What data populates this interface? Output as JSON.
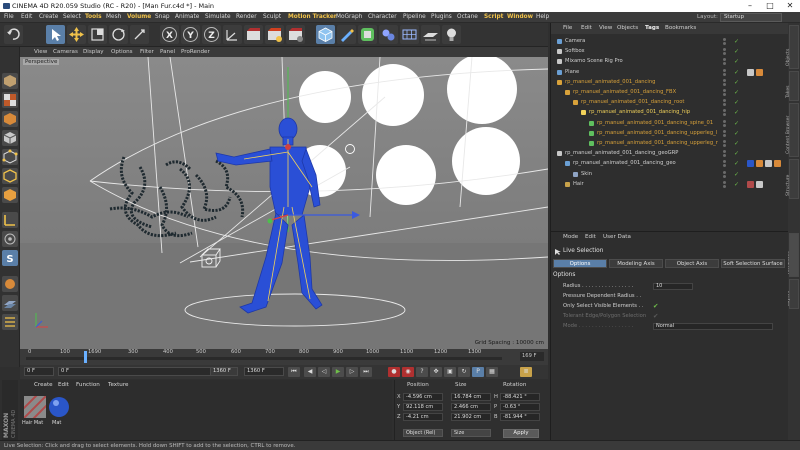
{
  "window": {
    "title": "CINEMA 4D R20.059 Studio (RC - R20) - [Man Fur.c4d *] - Main",
    "controls": [
      "–",
      "□",
      "✕"
    ]
  },
  "menubar": {
    "items": [
      "File",
      "Edit",
      "Create",
      "Select",
      "Tools",
      "Mesh",
      "Volume",
      "Snap",
      "Animate",
      "Simulate",
      "Render",
      "Sculpt",
      "Motion Tracker",
      "MoGraph",
      "Character",
      "Pipeline",
      "Plugins",
      "Octane",
      "Script",
      "Window",
      "Help"
    ],
    "highlighted": [
      "Tools",
      "Volume",
      "Motion Tracker",
      "Script",
      "Window"
    ],
    "layout_label": "Layout:",
    "layout_value": "Startup"
  },
  "toolbar": {
    "icons": [
      "undo-icon",
      "cursor-icon",
      "move-icon",
      "scale-icon",
      "rotate-icon",
      "recent-tools-icon",
      "x-axis-icon",
      "y-axis-icon",
      "z-axis-icon",
      "world-coords-icon",
      "render-view-icon",
      "render-picture-viewer-icon",
      "render-settings-icon",
      "cube-icon",
      "pen-icon",
      "subdivision-icon",
      "array-icon",
      "deformer-icon",
      "floor-icon",
      "camera-icon",
      "light-icon"
    ],
    "axis_labels": [
      "X",
      "Y",
      "Z"
    ]
  },
  "viewport": {
    "menu": [
      "View",
      "Cameras",
      "Display",
      "Options",
      "Filter",
      "Panel",
      "ProRender"
    ],
    "label": "Perspective",
    "grid_spacing": "Grid Spacing : 10000 cm"
  },
  "timeline": {
    "ticks": [
      "0",
      "100",
      "1690",
      "300",
      "400",
      "500",
      "600",
      "700",
      "800",
      "900",
      "1000",
      "1100",
      "1200",
      "1300"
    ],
    "end_frame": "169 F",
    "current_frame": "0 F",
    "min_field": "0 F",
    "max_field": "1360 F",
    "max_field2": "1360 F"
  },
  "materials": {
    "menu": [
      "Create",
      "Edit",
      "Function",
      "Texture"
    ],
    "items": [
      {
        "name": "Hair Mat",
        "color": "#b04a4a"
      },
      {
        "name": "Mat",
        "color": "#2a56c8"
      }
    ],
    "logo_line1": "MAXON",
    "logo_line2": "CINEMA 4D"
  },
  "coordinates": {
    "headers": [
      "Position",
      "Size",
      "Rotation"
    ],
    "rows": [
      {
        "axis": "X",
        "pos": "-4.596 cm",
        "size": "16.784 cm",
        "rot_label": "H",
        "rot": "-88.421 °"
      },
      {
        "axis": "Y",
        "pos": "92.118 cm",
        "size": "2.466 cm",
        "rot_label": "P",
        "rot": "-0.63 °"
      },
      {
        "axis": "Z",
        "pos": "-4.21 cm",
        "size": "21.902 cm",
        "rot_label": "B",
        "rot": "-81.944 °"
      }
    ],
    "mode": "Object (Rel)",
    "size_mode": "Size",
    "apply": "Apply"
  },
  "status": "Live Selection: Click and drag to select elements. Hold down SHIFT to add to the selection, CTRL to remove.",
  "objects": {
    "menu": [
      "File",
      "Edit",
      "View",
      "Objects",
      "Tags",
      "Bookmarks"
    ],
    "rows": [
      {
        "name": "Camera",
        "indent": 0,
        "color": "#d0d0d0",
        "icon": "#6a9fd4"
      },
      {
        "name": "Softbox",
        "indent": 0,
        "color": "#d0d0d0",
        "icon": "#c8c8c8"
      },
      {
        "name": "Mixamo Scene Rig Pro",
        "indent": 0,
        "color": "#d0d0d0",
        "icon": "#c8c8c8"
      },
      {
        "name": "Plane",
        "indent": 0,
        "color": "#d0d0d0",
        "icon": "#6a9fd4"
      },
      {
        "name": "rp_manuel_animated_001_dancing",
        "indent": 0,
        "color": "#d9a23a",
        "icon": "#d9a23a"
      },
      {
        "name": "rp_manuel_animated_001_dancing_FBX",
        "indent": 1,
        "color": "#d9a23a",
        "icon": "#d9a23a"
      },
      {
        "name": "rp_manuel_animated_001_dancing_root",
        "indent": 2,
        "color": "#d9a23a",
        "icon": "#d9a23a"
      },
      {
        "name": "rp_manuel_animated_001_dancing_hip",
        "indent": 3,
        "color": "#f2d25a",
        "icon": "#f2d25a"
      },
      {
        "name": "rp_manuel_animated_001_dancing_spine_01",
        "indent": 4,
        "color": "#d9a23a",
        "icon": "#5fbf5f"
      },
      {
        "name": "rp_manuel_animated_001_dancing_upperleg_l",
        "indent": 4,
        "color": "#d9a23a",
        "icon": "#5fbf5f"
      },
      {
        "name": "rp_manuel_animated_001_dancing_upperleg_r",
        "indent": 4,
        "color": "#d9a23a",
        "icon": "#5fbf5f"
      },
      {
        "name": "rp_manuel_animated_001_dancing_geoGRP",
        "indent": 0,
        "color": "#d0d0d0",
        "icon": "#c8c8c8"
      },
      {
        "name": "rp_manuel_animated_001_dancing_geo",
        "indent": 1,
        "color": "#d0d0d0",
        "icon": "#6a9fd4"
      },
      {
        "name": "Skin",
        "indent": 2,
        "color": "#d0d0d0",
        "icon": "#8fa4c4"
      },
      {
        "name": "Hair",
        "indent": 1,
        "color": "#d0d0d0",
        "icon": "#c8a24a"
      }
    ]
  },
  "right_tabs": [
    "Objects",
    "Takes",
    "Content Browser",
    "Structure",
    "Attributes",
    "Layers"
  ],
  "attributes": {
    "menu": [
      "Mode",
      "Edit",
      "User Data"
    ],
    "title": "Live Selection",
    "tabs": [
      "Options",
      "Modeling Axis",
      "Object Axis",
      "Soft Selection Surface"
    ],
    "active_tab": "Options",
    "section": "Options",
    "rows": [
      {
        "label": "Radius . . . . . . . . . . . . . . . .",
        "value": "10",
        "type": "field",
        "dim": false
      },
      {
        "label": "Pressure Dependent Radius . .",
        "value": "",
        "type": "check_off",
        "dim": false
      },
      {
        "label": "Only Select Visible Elements . .",
        "value": "✔",
        "type": "check",
        "dim": false
      },
      {
        "label": "Tolerant Edge/Polygon Selection",
        "value": "✔",
        "type": "check",
        "dim": true
      },
      {
        "label": "Mode . . . . . . . . . . . . . . . . .",
        "value": "Normal",
        "type": "field",
        "dim": true
      }
    ]
  },
  "colors": {
    "accent": "#f0c24a",
    "selection_blue": "#5a7fa8",
    "figure_blue": "#2a4fd6",
    "viewport_bg": "#808080"
  }
}
